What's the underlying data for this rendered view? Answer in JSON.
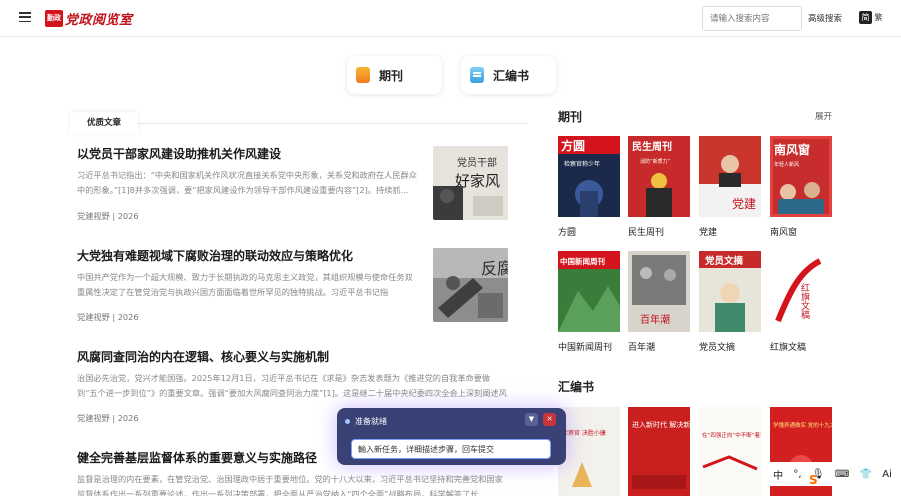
{
  "header": {
    "logo_mark": "勤政",
    "logo_text": "党政阅览室",
    "search_placeholder": "请输入搜索内容",
    "advanced_search": "高级搜索",
    "lang_simplified": "简",
    "lang_traditional": "繁"
  },
  "categories": [
    {
      "label": "期刊",
      "icon": "periodical-icon"
    },
    {
      "label": "汇编书",
      "icon": "compilation-book-icon"
    }
  ],
  "section_tab": "优质文章",
  "articles": [
    {
      "title": "以党员干部家风建设助推机关作风建设",
      "summary": "习近平总书记指出：“中央和国家机关作风状况直接关系党中央形象，关系党和政府在人民群众中的形象。”[1]8并多次强调，要“把家风建设作为领导干部作风建设重要内容”[2]。持续抓...",
      "meta": "党建视野 | 2026"
    },
    {
      "title": "大党独有难题视域下腐败治理的联动效应与策略优化",
      "summary": "中国共产党作为一个超大规模、致力于长期执政的马克思主义政党，其组织规模与使命任务双重属性决定了在管党治党与执政兴国方面面临着世所罕见的独特挑战。习近平总书记指出，“我...",
      "meta": "党建视野 | 2026"
    },
    {
      "title": "风腐同查同治的内在逻辑、核心要义与实施机制",
      "summary": "治国必先治党，党兴才能国强。2025年12月1日，习近平总书记在《求是》杂志发表题为《推进党的自我革命要做到“五个进一步到位”》的重要文章。强调“要加大风腐同查同治力度”[1]。这是继二十届中央纪委四次全会上深刻阐述风腐同...",
      "meta": "党建视野 | 2026"
    },
    {
      "title": "健全完善基层监督体系的重要意义与实施路径",
      "summary": "监督是治理的内在要素，在管党治党、治国理政中居于重要地位。党的十八大以来，习近平总书记坚持和完善党和国家监督体系作出一系列重要论述，作出一系列决策部署，把全面从严治党纳入“四个全面”战略布局，科学解答了长...",
      "meta": ""
    }
  ],
  "periodicals": {
    "heading": "期刊",
    "more": "展开",
    "items": [
      {
        "name": "方圆",
        "cover_title": "方圆",
        "cover_sub": "检察官称少年"
      },
      {
        "name": "民生周刊",
        "cover_title": "民生周刊",
        "cover_sub": "消防“新质力”"
      },
      {
        "name": "党建",
        "cover_title": "党建",
        "cover_sub": ""
      },
      {
        "name": "南风窗",
        "cover_title": "南风窗",
        "cover_sub": "年轻人新风"
      },
      {
        "name": "中国新闻周刊",
        "cover_title": "中国新闻周刊",
        "cover_sub": ""
      },
      {
        "name": "百年潮",
        "cover_title": "百年潮",
        "cover_sub": ""
      },
      {
        "name": "党员文摘",
        "cover_title": "党员文摘",
        "cover_sub": ""
      },
      {
        "name": "红旗文稿",
        "cover_title": "红旗文稿",
        "cover_sub": ""
      }
    ]
  },
  "compilations": {
    "heading": "汇编书",
    "items": [
      {
        "cover_title": "检察官 决胜小康"
      },
      {
        "cover_title": "进入新时代 解决新难题"
      },
      {
        "cover_title": "在“四强正向”中不断“着齐”"
      },
      {
        "cover_title": "学懂弄通做实 党的十九大精神"
      }
    ]
  },
  "float_panel": {
    "status": "准备就绪",
    "input_value": "輸入新任务，详细描述步骤，回车提交"
  },
  "ime": {
    "logo": "S",
    "lang": "中",
    "punct": "°,",
    "items": [
      "mic-icon",
      "keyboard-icon",
      "skin-icon",
      "ai-icon"
    ],
    "ai_label": "Ai"
  }
}
